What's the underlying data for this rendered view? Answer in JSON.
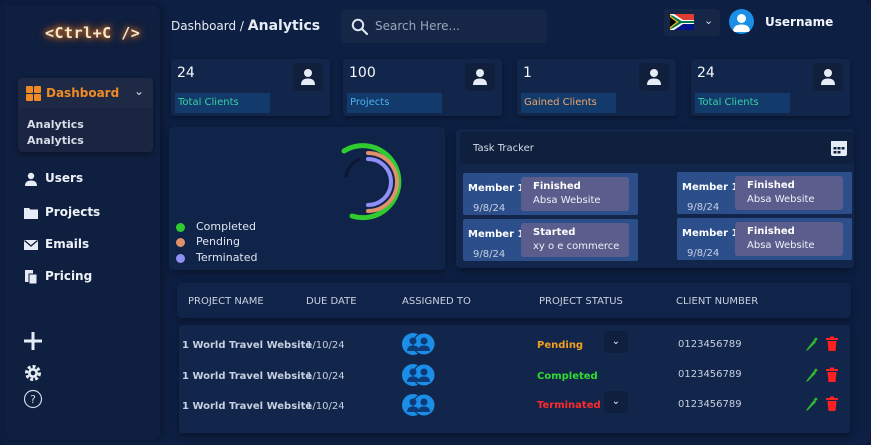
{
  "app": {
    "logo": "<Ctrl+C />"
  },
  "sidebar": {
    "dashboard_label": "Dashboard",
    "dashboard_subitems": [
      "Analytics",
      "Analytics"
    ],
    "items": [
      {
        "label": "Users",
        "icon": "user-icon"
      },
      {
        "label": "Projects",
        "icon": "folder-icon"
      },
      {
        "label": "Emails",
        "icon": "mail-icon"
      },
      {
        "label": "Pricing",
        "icon": "pricing-icon"
      }
    ],
    "bottom_icons": [
      "plus-icon",
      "settings-icon",
      "help-icon"
    ]
  },
  "header": {
    "breadcrumb_parent": "Dashboard /",
    "breadcrumb_current": "Analytics",
    "search_placeholder": "Search Here...",
    "username": "Username",
    "flag": "south-africa-flag-icon"
  },
  "stats": [
    {
      "value": "24",
      "label": "Total Clients",
      "color": "#38d3a2"
    },
    {
      "value": "100",
      "label": "Projects",
      "color": "#4db1f2"
    },
    {
      "value": "1",
      "label": "Gained Clients",
      "color": "#f0a36a"
    },
    {
      "value": "24",
      "label": "Total Clients",
      "color": "#38d3a2"
    }
  ],
  "donut": {
    "legend": [
      {
        "label": "Completed",
        "color": "#2fcc2f"
      },
      {
        "label": "Pending",
        "color": "#e0906a"
      },
      {
        "label": "Terminated",
        "color": "#8f8ff5"
      }
    ]
  },
  "tracker": {
    "title": "Task Tracker",
    "tasks": [
      {
        "member": "Member 1",
        "date": "9/8/24",
        "status": "Finished",
        "project": "Absa Website"
      },
      {
        "member": "Member 1",
        "date": "9/8/24",
        "status": "Finished",
        "project": "Absa Website"
      },
      {
        "member": "Member 1",
        "date": "9/8/24",
        "status": "Started",
        "project": "xy o e commerce"
      },
      {
        "member": "Member 1",
        "date": "9/8/24",
        "status": "Finished",
        "project": "Absa Website"
      }
    ]
  },
  "table": {
    "headers": [
      "PROJECT NAME",
      "DUE DATE",
      "ASSIGNED TO",
      "PROJECT STATUS",
      "CLIENT NUMBER"
    ],
    "rows": [
      {
        "project": "1 World Travel Website",
        "due": "1/10/24",
        "status": "Pending",
        "status_color": "#f0a020",
        "client": "0123456789"
      },
      {
        "project": "1 World Travel Website",
        "due": "1/10/24",
        "status": "Completed",
        "status_color": "#2fdc2f",
        "client": "0123456789"
      },
      {
        "project": "1 World Travel Website",
        "due": "1/10/24",
        "status": "Terminated",
        "status_color": "#ff2a2a",
        "client": "0123456789"
      }
    ]
  }
}
